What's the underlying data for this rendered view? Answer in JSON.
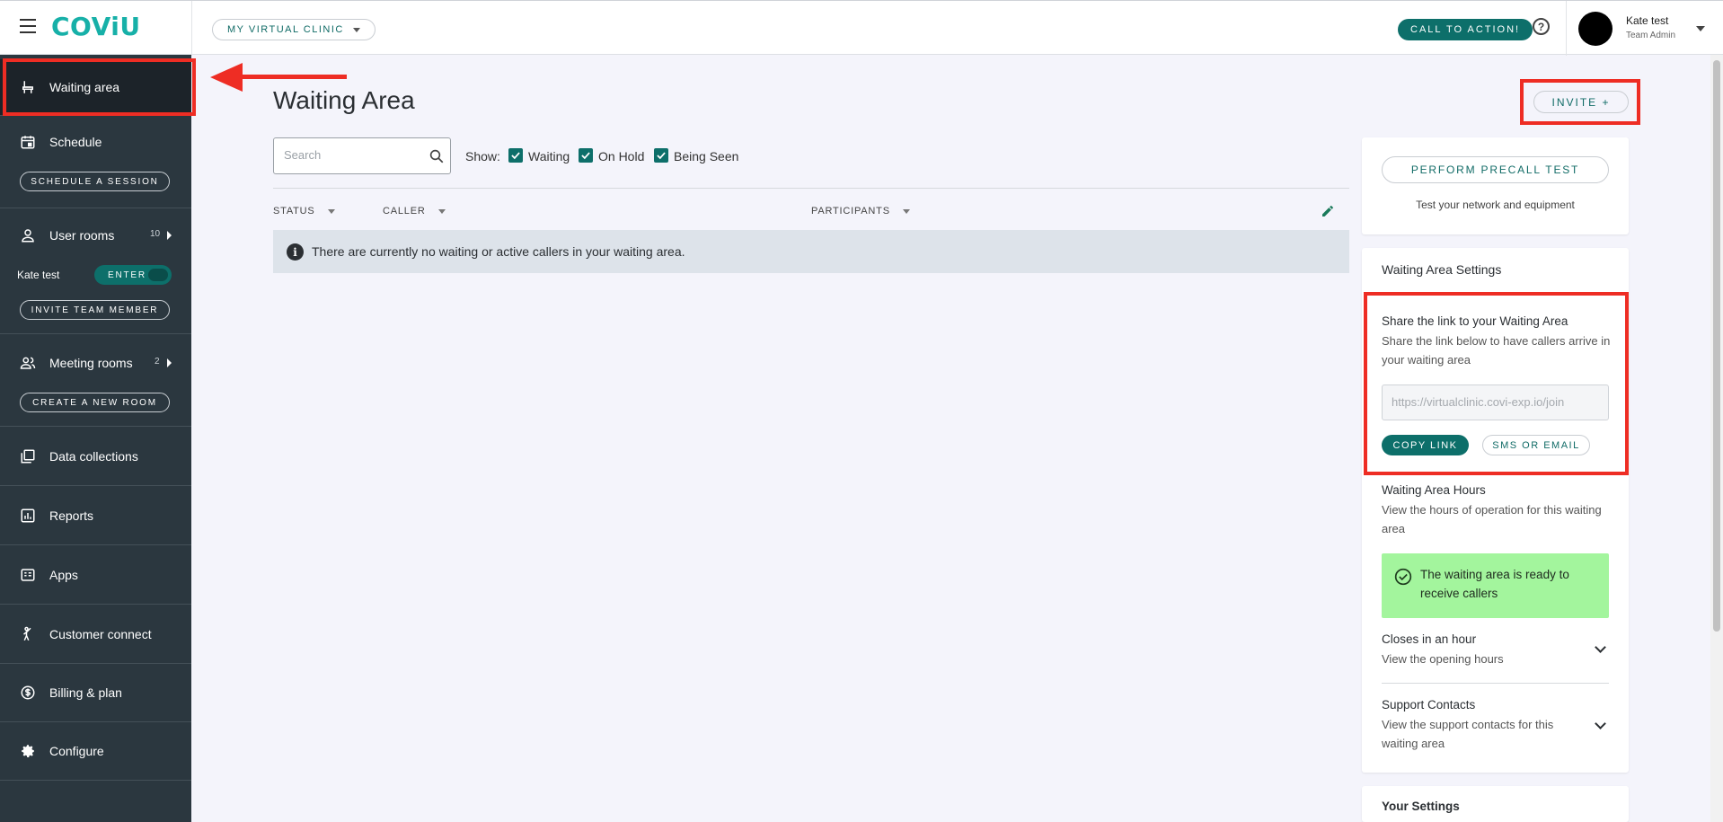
{
  "app": {
    "logo": "COViU",
    "clinic_selector": "MY VIRTUAL CLINIC",
    "cta_button": "CALL TO ACTION!",
    "help": "?",
    "user": {
      "name": "Kate test",
      "role": "Team Admin"
    }
  },
  "sidebar": {
    "waiting_area": "Waiting area",
    "schedule": "Schedule",
    "schedule_session": "SCHEDULE A SESSION",
    "user_rooms": "User rooms",
    "user_rooms_count": "10",
    "user_room_owner": "Kate test",
    "enter": "ENTER",
    "invite_team_member": "INVITE TEAM MEMBER",
    "meeting_rooms": "Meeting rooms",
    "meeting_rooms_count": "2",
    "create_room": "CREATE A NEW ROOM",
    "data_collections": "Data collections",
    "reports": "Reports",
    "apps": "Apps",
    "customer_connect": "Customer connect",
    "billing": "Billing & plan",
    "configure": "Configure"
  },
  "main": {
    "title": "Waiting Area",
    "invite": "INVITE +",
    "search_placeholder": "Search",
    "show_label": "Show:",
    "filters": [
      "Waiting",
      "On Hold",
      "Being Seen"
    ],
    "columns": [
      "STATUS",
      "CALLER",
      "PARTICIPANTS"
    ],
    "empty_message": "There are currently no waiting or active callers in your waiting area."
  },
  "panel": {
    "precall_button": "PERFORM PRECALL TEST",
    "precall_sub": "Test your network and equipment",
    "settings_title": "Waiting Area Settings",
    "share_title": "Share the link to your Waiting Area",
    "share_text": "Share the link below to have callers arrive in your waiting area",
    "link_placeholder": "https://virtualclinic.covi-exp.io/join",
    "copy_link": "COPY LINK",
    "sms_email": "SMS OR EMAIL",
    "hours_title": "Waiting Area Hours",
    "hours_text": "View the hours of operation for this waiting area",
    "ready_text": "The waiting area is ready to receive callers",
    "closes_title": "Closes in an hour",
    "closes_text": "View the opening hours",
    "support_title": "Support Contacts",
    "support_text": "View the support contacts for this waiting area",
    "your_settings": "Your Settings"
  },
  "colors": {
    "accent": "#0d6f6a",
    "logo": "#17b0a8",
    "sidebar": "#2b373f",
    "highlight": "#ee2d24",
    "ready": "#a3f59d"
  }
}
